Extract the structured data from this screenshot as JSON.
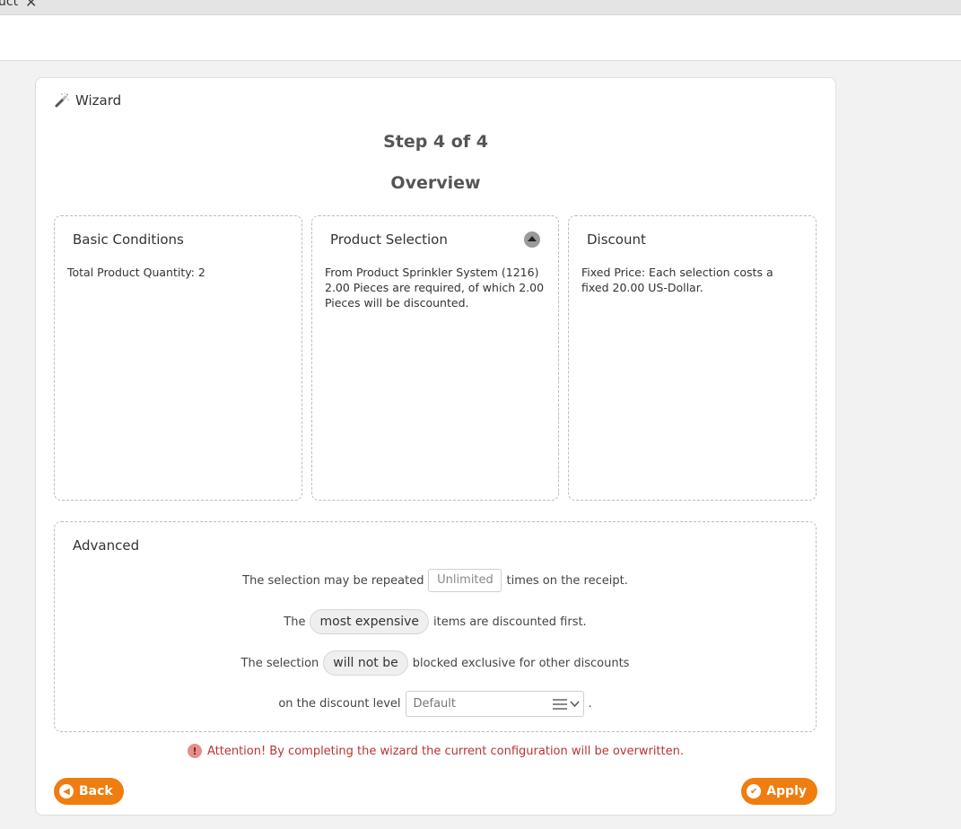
{
  "tab": {
    "title": "uct",
    "close_glyph": "✕"
  },
  "wizard": {
    "header": "Wizard",
    "icon": "magic-wand-icon",
    "step": "Step 4 of 4",
    "subtitle": "Overview"
  },
  "panels": {
    "basic": {
      "title": "Basic Conditions",
      "text": "Total Product Quantity: 2"
    },
    "product": {
      "title": "Product Selection",
      "text": "From Product Sprinkler System (1216) 2.00 Pieces are required, of which 2.00 Pieces will be discounted."
    },
    "discount": {
      "title": "Discount",
      "text": "Fixed Price: Each selection costs a fixed 20.00 US-Dollar."
    }
  },
  "advanced": {
    "title": "Advanced",
    "repeat_prefix": "The selection may be repeated",
    "repeat_value": "Unlimited",
    "repeat_suffix": "times on the receipt.",
    "order_prefix": "The",
    "order_value": "most expensive",
    "order_suffix": "items are discounted first.",
    "block_prefix": "The selection",
    "block_value": "will not be",
    "block_suffix": "blocked exclusive for other discounts",
    "level_prefix": "on the discount level",
    "level_value": "Default",
    "level_suffix": "."
  },
  "attention": "Attention! By completing the wizard the current configuration will be overwritten.",
  "buttons": {
    "back": "Back",
    "apply": "Apply"
  },
  "colors": {
    "accent": "#ef7d0f",
    "warning": "#b33333"
  }
}
